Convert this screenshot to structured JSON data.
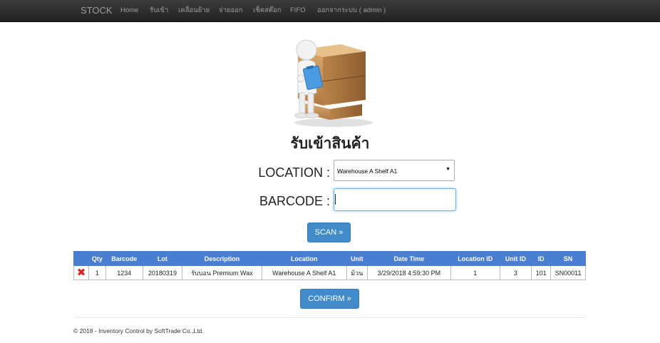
{
  "navbar": {
    "brand": "STOCK",
    "items": [
      {
        "label": "Home"
      },
      {
        "label": "รับเข้า"
      },
      {
        "label": "เคลื่อนย้าย"
      },
      {
        "label": "จ่ายออก"
      },
      {
        "label": "เช็คสต๊อก"
      },
      {
        "label": "FIFO"
      },
      {
        "label": "ออกจากระบบ ( admin )"
      }
    ]
  },
  "page": {
    "title": "รับเข้าสินค้า"
  },
  "form": {
    "location_label": "LOCATION :",
    "location_value": "Warehouse A Shelf A1",
    "barcode_label": "BARCODE :",
    "barcode_value": "",
    "scan_button": "SCAN »"
  },
  "table": {
    "headers": [
      "",
      "Qty",
      "Barcode",
      "Lot",
      "Description",
      "Location",
      "Unit",
      "Date Time",
      "Location ID",
      "Unit ID",
      "ID",
      "SN"
    ],
    "rows": [
      [
        "1",
        "1234",
        "20180319",
        "รับบอน Premium Wax",
        "Warehouse A Shelf A1",
        "ม้วน",
        "3/29/2018 4:59:30 PM",
        "1",
        "3",
        "101",
        "SN00011"
      ]
    ]
  },
  "confirm_button": "CONFIRM »",
  "footer": "© 2018 - Inventory Control by SoftTrade Co.,Ltd.",
  "icons": {
    "delete": "close-x-icon",
    "colors": {
      "delete": "#e02020",
      "accent": "#428bca",
      "table_header": "#4a7ed0"
    }
  }
}
